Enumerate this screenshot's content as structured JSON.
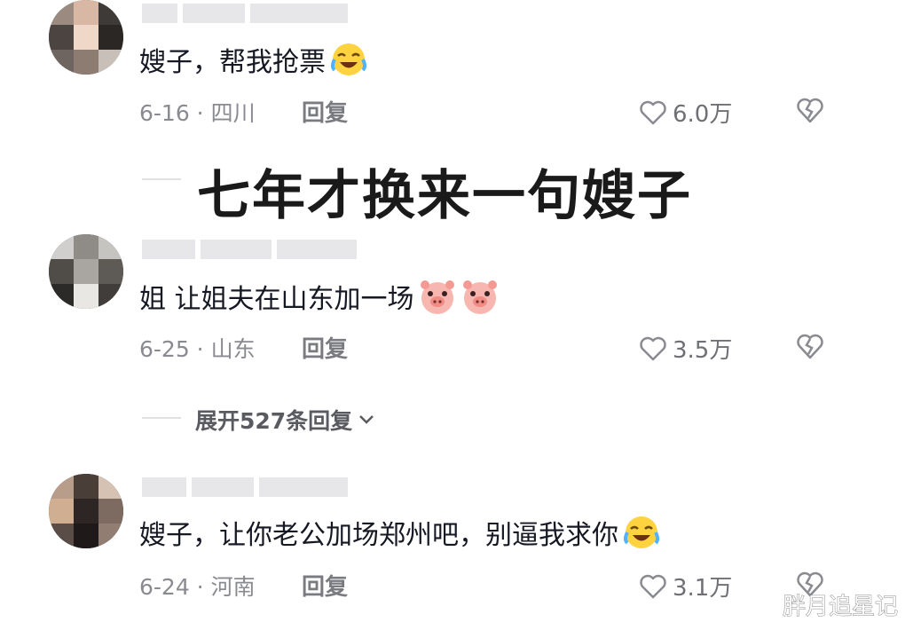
{
  "overlay_title": "七年才换来一句嫂子",
  "watermark": "胖月追星记",
  "comments": [
    {
      "text": "嫂子，帮我抢票",
      "emoji": "crying-laughing-emoji",
      "date_location": "6-16 · 四川",
      "reply_label": "回复",
      "likes": "6.0万"
    },
    {
      "text": "姐 让姐夫在山东加一场",
      "emoji": "pig-face-emoji",
      "date_location": "6-25 · 山东",
      "reply_label": "回复",
      "likes": "3.5万",
      "expand_label": "展开527条回复"
    },
    {
      "text": "嫂子，让你老公加场郑州吧，别逼我求你",
      "emoji": "crying-laughing-emoji",
      "date_location": "6-24 · 河南",
      "reply_label": "回复",
      "likes": "3.1万"
    }
  ],
  "colors": {
    "text": "#161823",
    "meta": "#8a8b91",
    "icon": "#6f7075"
  }
}
